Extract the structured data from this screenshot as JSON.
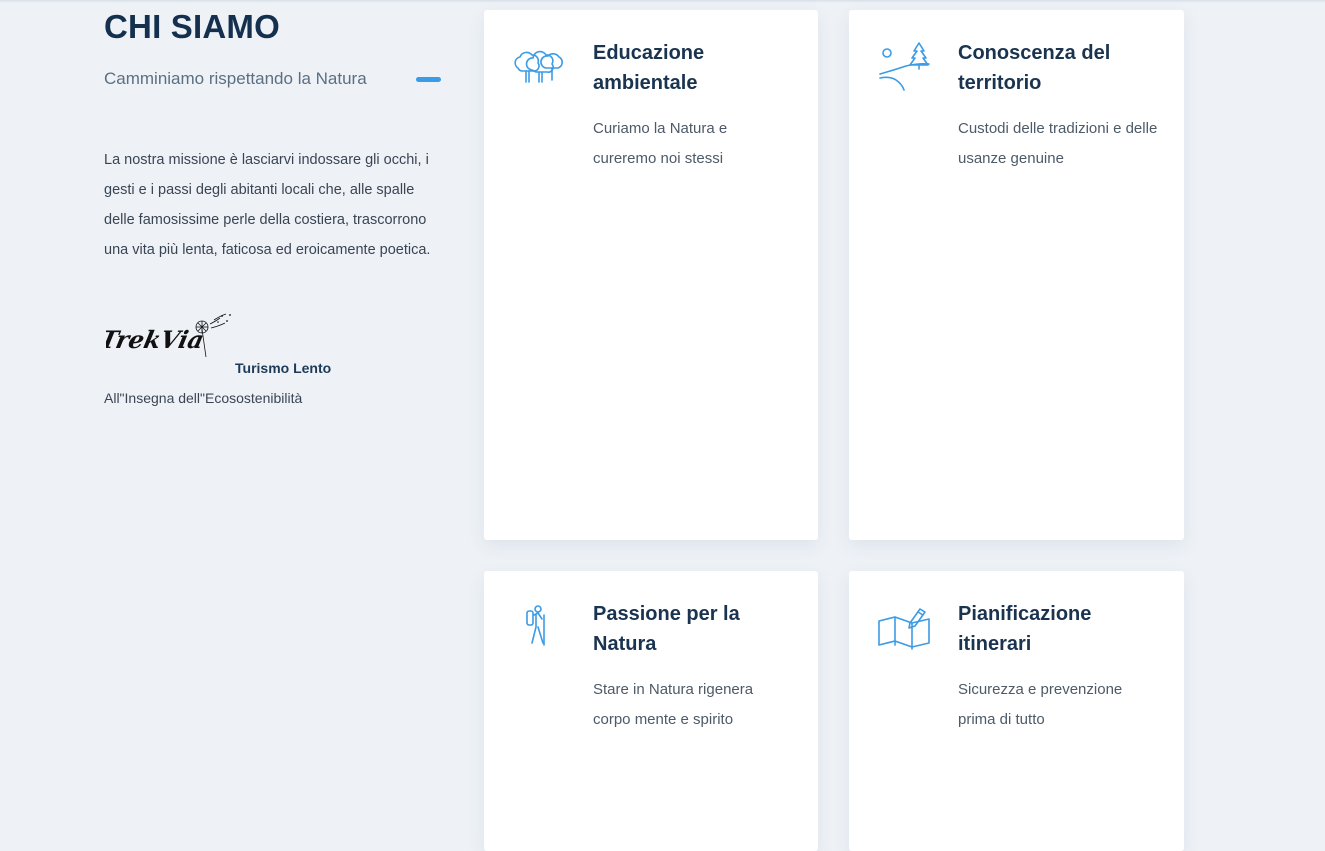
{
  "section": {
    "title": "CHI SIAMO",
    "subtitle": "Camminiamo rispettando la Natura",
    "mission": "La nostra missione è lasciarvi indossare gli occhi, i gesti e i passi degli abitanti locali che, alle spalle delle famosissime perle della costiera, trascorrono una vita più lenta, faticosa ed eroicamente poetica.",
    "brand": {
      "logo_text": "TrekVia",
      "tagline": "Turismo Lento",
      "eco_line": "All\"Insegna dell\"Ecosostenibilità"
    }
  },
  "colors": {
    "accent": "#3a9be6",
    "heading": "#14304e",
    "background": "#eef2f7"
  },
  "cards": [
    {
      "icon": "trees-icon",
      "title": "Educazione ambientale",
      "text": "Curiamo la Natura e cureremo noi stessi"
    },
    {
      "icon": "landscape-pine-icon",
      "title": "Conoscenza del territorio",
      "text": "Custodi delle tradizioni e delle usanze genuine"
    },
    {
      "icon": "hiker-icon",
      "title": "Passione per la Natura",
      "text": "Stare in Natura rigenera corpo mente e spirito"
    },
    {
      "icon": "map-pencil-icon",
      "title": "Pianificazione itinerari",
      "text": "Sicurezza e prevenzione prima di tutto"
    }
  ]
}
